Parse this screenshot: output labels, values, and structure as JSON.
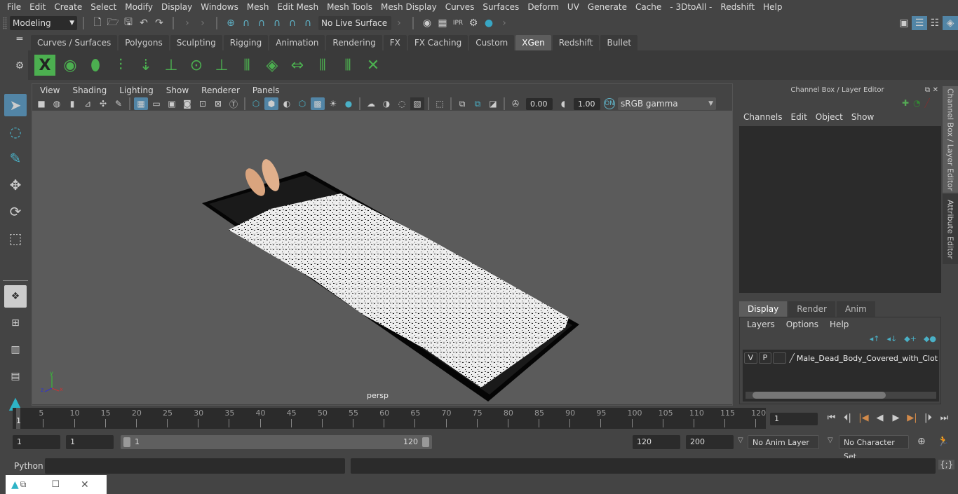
{
  "menubar": [
    "File",
    "Edit",
    "Create",
    "Select",
    "Modify",
    "Display",
    "Windows",
    "Mesh",
    "Edit Mesh",
    "Mesh Tools",
    "Mesh Display",
    "Curves",
    "Surfaces",
    "Deform",
    "UV",
    "Generate",
    "Cache",
    "- 3DtoAll -",
    "Redshift",
    "Help"
  ],
  "statusline": {
    "mode": "Modeling",
    "live_surface": "No Live Surface",
    "render_icons": [
      "render-view-icon",
      "render-frame-icon",
      "ipr-render-icon",
      "render-settings-icon",
      "hypershade-icon"
    ]
  },
  "shelf": {
    "tabs": [
      {
        "label": "Curves / Surfaces",
        "active": false
      },
      {
        "label": "Polygons",
        "active": false
      },
      {
        "label": "Sculpting",
        "active": false
      },
      {
        "label": "Rigging",
        "active": false
      },
      {
        "label": "Animation",
        "active": false
      },
      {
        "label": "Rendering",
        "active": false
      },
      {
        "label": "FX",
        "active": false
      },
      {
        "label": "FX Caching",
        "active": false
      },
      {
        "label": "Custom",
        "active": false
      },
      {
        "label": "XGen",
        "active": true
      },
      {
        "label": "Redshift",
        "active": false
      },
      {
        "label": "Bullet",
        "active": false
      }
    ],
    "icons": [
      "xgen-editor-icon",
      "preview-show-icon",
      "preview-hide-icon",
      "add-guides-icon",
      "place-on-surface-icon",
      "add-guide-icon",
      "show-guides-icon",
      "lock-guides-icon",
      "split-guides-icon",
      "patch-icon",
      "mirror-guides-icon",
      "select-guides-icon",
      "guide-bounds-icon",
      "delete-guides-icon"
    ]
  },
  "viewport": {
    "menu": [
      "View",
      "Shading",
      "Lighting",
      "Show",
      "Renderer",
      "Panels"
    ],
    "exposure": "0.00",
    "gamma": "1.00",
    "color_space": "sRGB gamma",
    "camera_label": "persp",
    "axis": {
      "x": "x",
      "y": "y",
      "z": "z"
    }
  },
  "channel_box": {
    "title": "Channel Box / Layer Editor",
    "menu": [
      "Channels",
      "Edit",
      "Object",
      "Show"
    ]
  },
  "side_tabs": [
    "Channel Box / Layer Editor",
    "Attribute Editor"
  ],
  "layer_editor": {
    "tabs": [
      {
        "label": "Display",
        "active": true
      },
      {
        "label": "Render",
        "active": false
      },
      {
        "label": "Anim",
        "active": false
      }
    ],
    "menu": [
      "Layers",
      "Options",
      "Help"
    ],
    "layers": [
      {
        "v": "V",
        "p": "P",
        "name": "Male_Dead_Body_Covered_with_Clot"
      }
    ]
  },
  "timeline": {
    "ticks": [
      5,
      10,
      15,
      20,
      25,
      30,
      35,
      40,
      45,
      50,
      55,
      60,
      65,
      70,
      75,
      80,
      85,
      90,
      95,
      100,
      105,
      110,
      115,
      120
    ],
    "current_frame_marker": "1",
    "current_frame": "1"
  },
  "range": {
    "start": "1",
    "playback_start": "1",
    "slider_start": "1",
    "slider_end": "120",
    "playback_end": "120",
    "end": "200",
    "anim_layer": "No Anim Layer",
    "character_set": "No Character Set"
  },
  "command_line": {
    "label": "Python",
    "value": ""
  }
}
